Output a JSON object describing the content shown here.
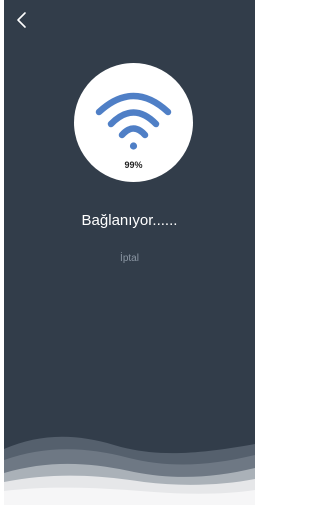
{
  "navigation": {
    "back_icon": "chevron-left-icon"
  },
  "connection": {
    "icon": "wifi-icon",
    "progress_text": "99%",
    "progress": 99,
    "status_text": "Bağlanıyor......",
    "cancel_label": "İptal"
  },
  "colors": {
    "background": "#323d4a",
    "accent": "#4f7fc6",
    "circle": "#ffffff",
    "status_text": "#ffffff",
    "cancel_text": "#8a95a2"
  }
}
